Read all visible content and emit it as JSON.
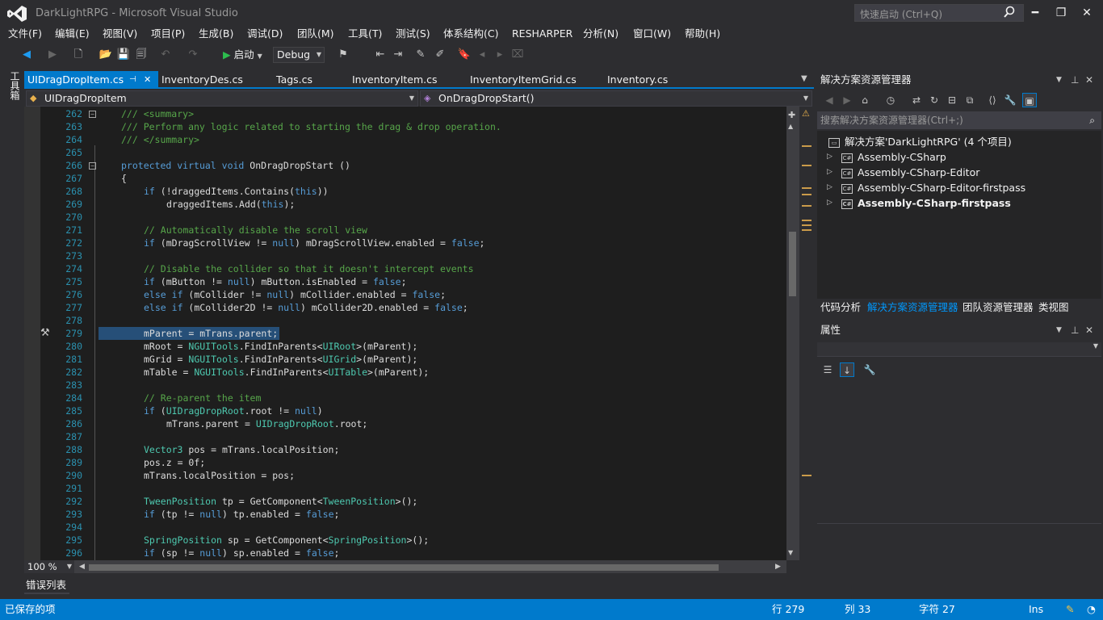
{
  "window": {
    "title": "DarkLightRPG - Microsoft Visual Studio",
    "quick_launch_placeholder": "快速启动 (Ctrl+Q)",
    "minimize": "━",
    "restore": "❐",
    "close": "✕"
  },
  "menu": [
    "文件(F)",
    "编辑(E)",
    "视图(V)",
    "项目(P)",
    "生成(B)",
    "调试(D)",
    "团队(M)",
    "工具(T)",
    "测试(S)",
    "体系结构(C)",
    "RESHARPER",
    "分析(N)",
    "窗口(W)",
    "帮助(H)"
  ],
  "toolbar": {
    "start_label": "启动",
    "configuration": "Debug"
  },
  "toolbox_label": "工具箱",
  "tabs": [
    {
      "label": "UIDragDropItem.cs",
      "active": true
    },
    {
      "label": "InventoryDes.cs",
      "active": false
    },
    {
      "label": "Tags.cs",
      "active": false
    },
    {
      "label": "InventoryItem.cs",
      "active": false
    },
    {
      "label": "InventoryItemGrid.cs",
      "active": false
    },
    {
      "label": "Inventory.cs",
      "active": false
    }
  ],
  "tab_pin": "⊣",
  "tab_close": "✕",
  "nav": {
    "type_selector": "UIDragDropItem",
    "member_selector": "OnDragDropStart()"
  },
  "code_lines": [
    {
      "num": "262",
      "text": "/// <summary>",
      "kind": "c",
      "indent": 0,
      "collapse": "−"
    },
    {
      "num": "263",
      "text": "/// Perform any logic related to starting the drag & drop operation.",
      "kind": "c",
      "indent": 0
    },
    {
      "num": "264",
      "text": "/// </summary>",
      "kind": "c",
      "indent": 0
    },
    {
      "num": "265",
      "text": "",
      "kind": "p",
      "indent": 0
    },
    {
      "num": "266",
      "text": "protected virtual void OnDragDropStart ()",
      "kind": "sig",
      "indent": 0,
      "collapse": "−"
    },
    {
      "num": "267",
      "text": "{",
      "kind": "p",
      "indent": 0
    },
    {
      "num": "268",
      "text": "if (!draggedItems.Contains(this))",
      "kind": "p",
      "indent": 1
    },
    {
      "num": "269",
      "text": "draggedItems.Add(this);",
      "kind": "p",
      "indent": 2
    },
    {
      "num": "270",
      "text": "",
      "kind": "p",
      "indent": 0
    },
    {
      "num": "271",
      "text": "// Automatically disable the scroll view",
      "kind": "c",
      "indent": 1
    },
    {
      "num": "272",
      "text": "if (mDragScrollView != null) mDragScrollView.enabled = false;",
      "kind": "p",
      "indent": 1
    },
    {
      "num": "273",
      "text": "",
      "kind": "p",
      "indent": 0
    },
    {
      "num": "274",
      "text": "// Disable the collider so that it doesn't intercept events",
      "kind": "c",
      "indent": 1
    },
    {
      "num": "275",
      "text": "if (mButton != null) mButton.isEnabled = false;",
      "kind": "p",
      "indent": 1
    },
    {
      "num": "276",
      "text": "else if (mCollider != null) mCollider.enabled = false;",
      "kind": "p",
      "indent": 1
    },
    {
      "num": "277",
      "text": "else if (mCollider2D != null) mCollider2D.enabled = false;",
      "kind": "p",
      "indent": 1
    },
    {
      "num": "278",
      "text": "",
      "kind": "p",
      "indent": 0
    },
    {
      "num": "279",
      "text": "mParent = mTrans.parent;",
      "kind": "p",
      "indent": 1
    },
    {
      "num": "280",
      "text": "mRoot = NGUITools.FindInParents<UIRoot>(mParent);",
      "kind": "p",
      "indent": 1
    },
    {
      "num": "281",
      "text": "mGrid = NGUITools.FindInParents<UIGrid>(mParent);",
      "kind": "p",
      "indent": 1
    },
    {
      "num": "282",
      "text": "mTable = NGUITools.FindInParents<UITable>(mParent);",
      "kind": "p",
      "indent": 1
    },
    {
      "num": "283",
      "text": "",
      "kind": "p",
      "indent": 0
    },
    {
      "num": "284",
      "text": "// Re-parent the item",
      "kind": "c",
      "indent": 1
    },
    {
      "num": "285",
      "text": "if (UIDragDropRoot.root != null)",
      "kind": "p",
      "indent": 1
    },
    {
      "num": "286",
      "text": "mTrans.parent = UIDragDropRoot.root;",
      "kind": "p",
      "indent": 2
    },
    {
      "num": "287",
      "text": "",
      "kind": "p",
      "indent": 0
    },
    {
      "num": "288",
      "text": "Vector3 pos = mTrans.localPosition;",
      "kind": "p",
      "indent": 1
    },
    {
      "num": "289",
      "text": "pos.z = 0f;",
      "kind": "p",
      "indent": 1
    },
    {
      "num": "290",
      "text": "mTrans.localPosition = pos;",
      "kind": "p",
      "indent": 1
    },
    {
      "num": "291",
      "text": "",
      "kind": "p",
      "indent": 0
    },
    {
      "num": "292",
      "text": "TweenPosition tp = GetComponent<TweenPosition>();",
      "kind": "p",
      "indent": 1
    },
    {
      "num": "293",
      "text": "if (tp != null) tp.enabled = false;",
      "kind": "p",
      "indent": 1
    },
    {
      "num": "294",
      "text": "",
      "kind": "p",
      "indent": 0
    },
    {
      "num": "295",
      "text": "SpringPosition sp = GetComponent<SpringPosition>();",
      "kind": "p",
      "indent": 1
    },
    {
      "num": "296",
      "text": "if (sp != null) sp.enabled = false;",
      "kind": "p",
      "indent": 1
    }
  ],
  "editor": {
    "zoom": "100 %"
  },
  "error_list_tab": "错误列表",
  "status": {
    "message": "已保存的项",
    "line": "行 279",
    "col": "列 33",
    "char": "字符 27",
    "mode": "Ins"
  },
  "solution_explorer": {
    "title": "解决方案资源管理器",
    "search_placeholder": "搜索解决方案资源管理器(Ctrl+;)",
    "solution": "解决方案'DarkLightRPG' (4 个项目)",
    "projects": [
      {
        "name": "Assembly-CSharp",
        "bold": false
      },
      {
        "name": "Assembly-CSharp-Editor",
        "bold": false
      },
      {
        "name": "Assembly-CSharp-Editor-firstpass",
        "bold": false
      },
      {
        "name": "Assembly-CSharp-firstpass",
        "bold": true
      }
    ]
  },
  "bottom_tabs": [
    {
      "label": "代码分析",
      "active": false
    },
    {
      "label": "解决方案资源管理器",
      "active": true
    },
    {
      "label": "团队资源管理器",
      "active": false
    },
    {
      "label": "类视图",
      "active": false
    }
  ],
  "properties": {
    "title": "属性"
  },
  "colors": {
    "accent": "#007acc",
    "comment": "#57a64a",
    "keyword": "#569cd6",
    "type": "#4ec9b0",
    "line_number": "#2b91af"
  }
}
